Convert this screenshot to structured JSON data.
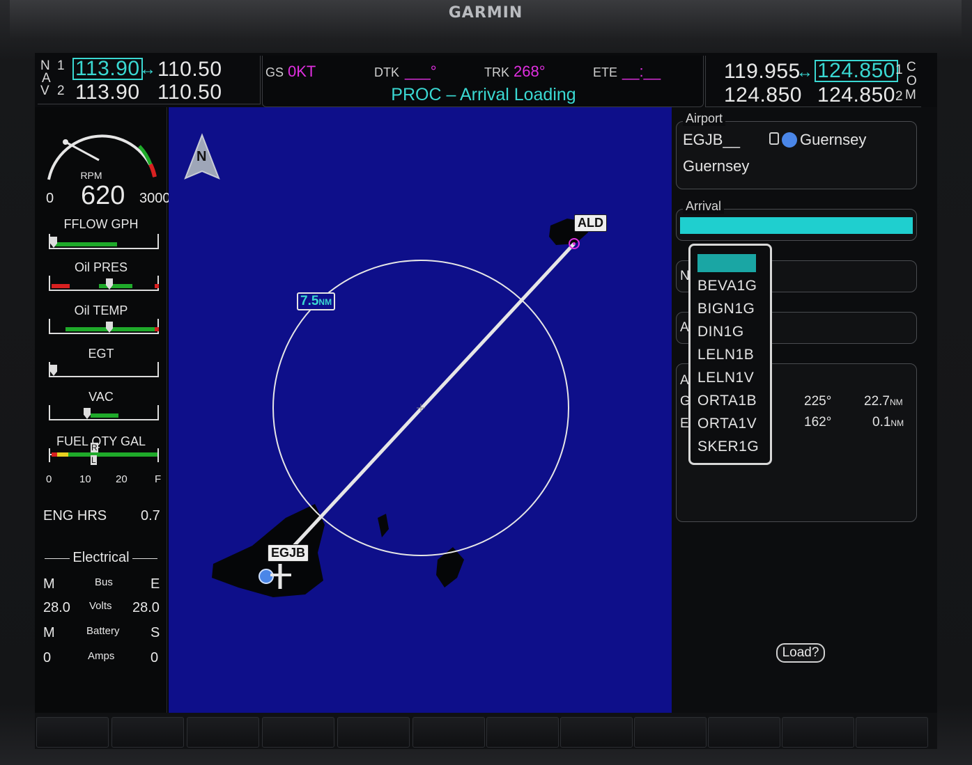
{
  "brand": "GARMIN",
  "nav": {
    "label_n": "N",
    "label_a": "A",
    "label_v": "V",
    "line1_index": "1",
    "line2_index": "2",
    "nav1_active": "113.90",
    "nav1_standby": "110.50",
    "nav2_active": "113.90",
    "nav2_standby": "110.50",
    "swap": "↔"
  },
  "databar": {
    "gs_label": "GS",
    "gs_value": "0KT",
    "dtk_label": "DTK",
    "dtk_value": "___°",
    "trk_label": "TRK",
    "trk_value": "268°",
    "ete_label": "ETE",
    "ete_value": "__:__",
    "message": "PROC – Arrival Loading"
  },
  "com": {
    "label_c": "C",
    "label_o": "O",
    "label_m": "M",
    "line1_index": "1",
    "line2_index": "2",
    "com1_standby": "119.955",
    "com1_active": "124.850",
    "com2_standby": "124.850",
    "com2_active": "124.850",
    "swap": "↔"
  },
  "engine": {
    "rpm_label": "RPM",
    "rpm_value": "620",
    "rpm_min": "0",
    "rpm_max": "3000",
    "fflow_label": "FFLOW GPH",
    "oil_pres_label": "Oil PRES",
    "oil_temp_label": "Oil TEMP",
    "egt_label": "EGT",
    "vac_label": "VAC",
    "fuel_label": "FUEL QTY GAL",
    "fuel_ticks": [
      "0",
      "10",
      "20",
      "F"
    ],
    "fuel_r": "R",
    "fuel_l": "L",
    "eng_hrs_label": "ENG HRS",
    "eng_hrs_value": "0.7",
    "electrical_label": "Electrical",
    "elec_rows": [
      {
        "left": "M",
        "mid": "Bus",
        "right": "E"
      },
      {
        "left": "28.0",
        "mid": "Volts",
        "right": "28.0"
      },
      {
        "left": "M",
        "mid": "Battery",
        "right": "S"
      },
      {
        "left": "0",
        "mid": "Amps",
        "right": "0"
      }
    ]
  },
  "map": {
    "north": "N",
    "range_value": "7.5",
    "range_unit": "NM",
    "waypoint_dest": "ALD",
    "waypoint_origin": "EGJB"
  },
  "proc": {
    "airport_label": "Airport",
    "airport_ident": "EGJB__",
    "airport_name_top": "Guernsey",
    "airport_city": "Guernsey",
    "arrival_label": "Arrival",
    "partial_n": "N",
    "partial_a1": "A",
    "partial_a2": "A",
    "partial_g": "G",
    "partial_e": "E",
    "arrivals": [
      "BEVA1G",
      "BIGN1G",
      "DIN1G",
      "LELN1B",
      "LELN1V",
      "ORTA1B",
      "ORTA1V",
      "SKER1G"
    ],
    "row1_crs": "225°",
    "row1_dist": "22.7",
    "row1_unit": "NM",
    "row2_crs": "162°",
    "row2_dist": "0.1",
    "row2_unit": "NM",
    "load_button": "Load?"
  },
  "colors": {
    "cyan": "#3ad8d2",
    "magenta": "#e02fe0",
    "map_water": "#0e0f8a"
  }
}
